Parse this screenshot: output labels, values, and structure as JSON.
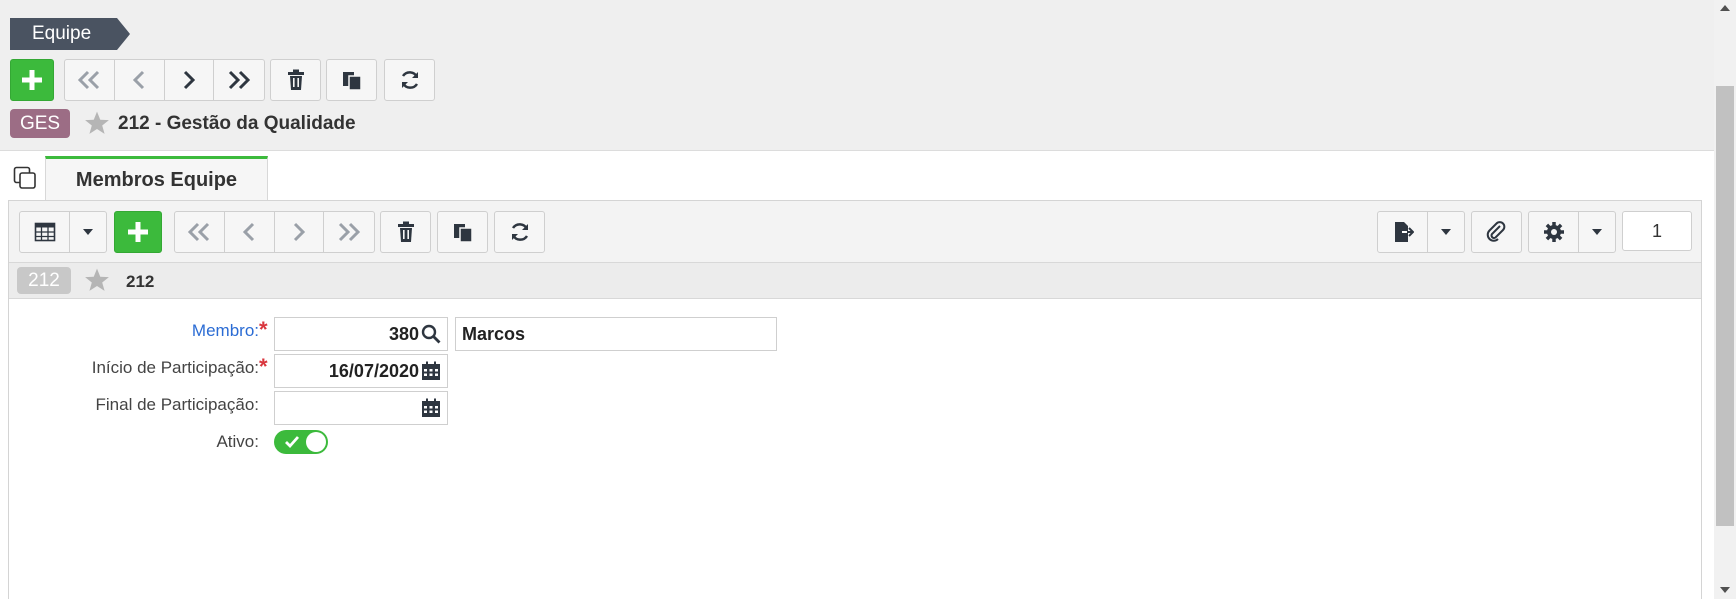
{
  "breadcrumb": {
    "label": "Equipe"
  },
  "record": {
    "tag": "GES",
    "title": "212 - Gestão da Qualidade"
  },
  "tabs": [
    {
      "label": "Membros Equipe"
    }
  ],
  "subrecord": {
    "tag": "212",
    "title": "212"
  },
  "pager": {
    "value": "1"
  },
  "form": {
    "membro": {
      "label": "Membro:",
      "code": "380",
      "name": "Marcos"
    },
    "inicio": {
      "label": "Início de Participação:",
      "value": "16/07/2020"
    },
    "final": {
      "label": "Final de Participação:",
      "value": ""
    },
    "ativo": {
      "label": "Ativo:",
      "enabled": true
    }
  },
  "colors": {
    "accent": "#3cba3c",
    "breadcrumb_bg": "#4a5361",
    "tag_record": "#9c6d85",
    "tag_sub": "#c8c8c8",
    "link": "#2b6cd4",
    "required": "#d9363e"
  }
}
